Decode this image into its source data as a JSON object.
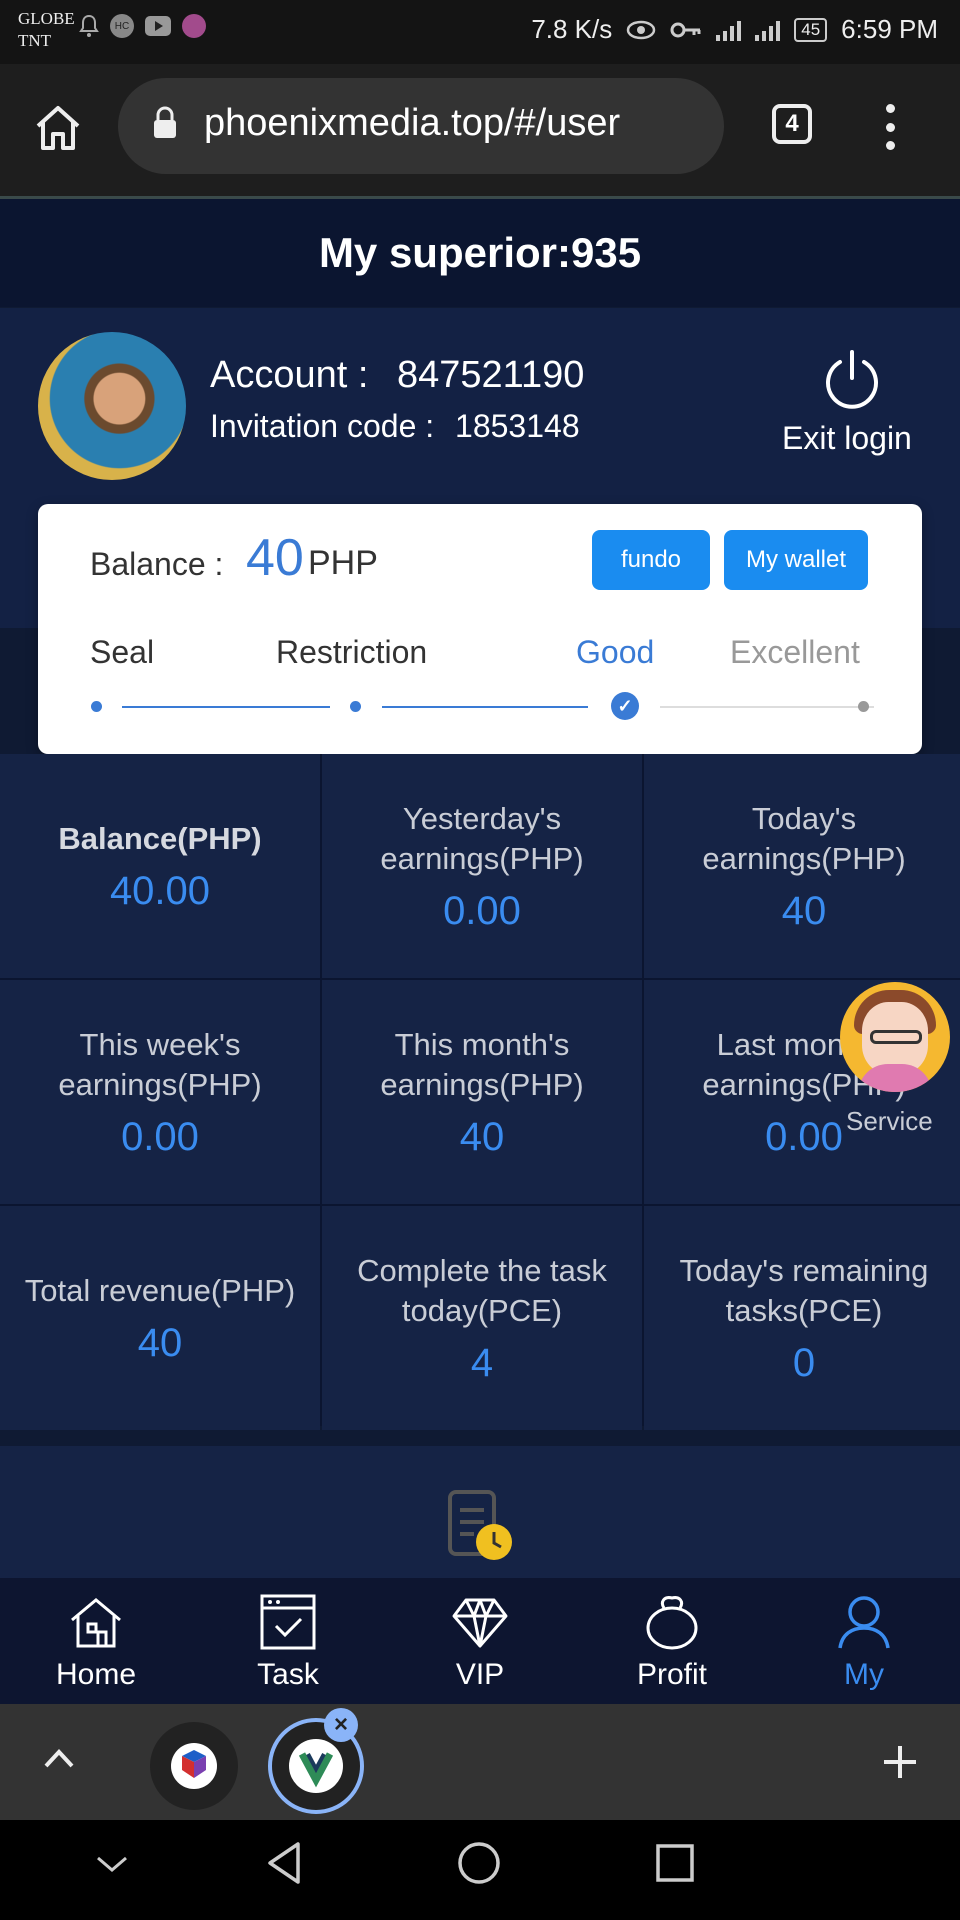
{
  "status_bar": {
    "carrier_1": "GLOBE",
    "carrier_2": "TNT",
    "speed": "7.8 K/s",
    "battery": "45",
    "time": "6:59 PM"
  },
  "browser": {
    "url": "phoenixmedia.top/#/user",
    "tab_count": "4"
  },
  "header": {
    "title": "My superior:935"
  },
  "profile": {
    "account_label": "Account :",
    "account_value": "847521190",
    "invite_label": "Invitation code :",
    "invite_value": "1853148",
    "exit_label": "Exit login"
  },
  "balance_card": {
    "label": "Balance :",
    "value": "40",
    "unit": "PHP",
    "fundo_button": "fundo",
    "wallet_button": "My wallet",
    "levels": [
      "Seal",
      "Restriction",
      "Good",
      "Excellent"
    ],
    "current_level": "Good"
  },
  "stats": [
    {
      "label": "Balance(PHP)",
      "value": "40.00"
    },
    {
      "label": "Yesterday's earnings(PHP)",
      "value": "0.00"
    },
    {
      "label": "Today's earnings(PHP)",
      "value": "40"
    },
    {
      "label": "This week's earnings(PHP)",
      "value": "0.00"
    },
    {
      "label": "This month's earnings(PHP)",
      "value": "40"
    },
    {
      "label": "Last month's earnings(PHP)",
      "value": "0.00"
    },
    {
      "label": "Total revenue(PHP)",
      "value": "40"
    },
    {
      "label": "Complete the task today(PCE)",
      "value": "4"
    },
    {
      "label": "Today's remaining tasks(PCE)",
      "value": "0"
    }
  ],
  "service": {
    "label": "Service"
  },
  "bottom_nav": [
    {
      "label": "Home",
      "icon": "home-icon"
    },
    {
      "label": "Task",
      "icon": "task-icon"
    },
    {
      "label": "VIP",
      "icon": "diamond-icon"
    },
    {
      "label": "Profit",
      "icon": "money-bag-icon"
    },
    {
      "label": "My",
      "icon": "user-icon",
      "active": true
    }
  ],
  "colors": {
    "accent": "#3a8cf0",
    "button": "#1a8cf0",
    "background": "#152345"
  }
}
